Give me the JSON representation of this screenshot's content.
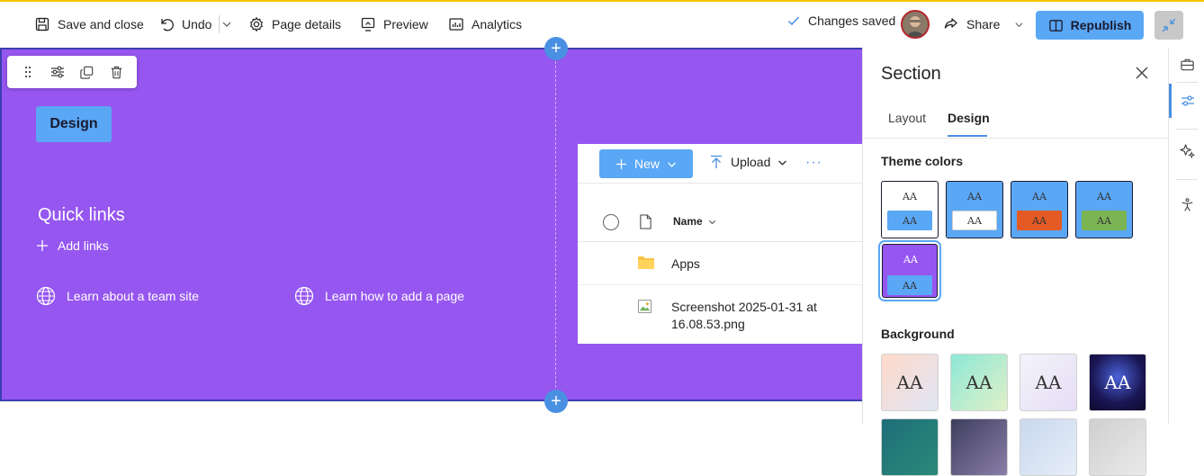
{
  "toolbar": {
    "save_close": "Save and close",
    "undo": "Undo",
    "page_details": "Page details",
    "preview": "Preview",
    "analytics": "Analytics",
    "status": "Changes saved",
    "share": "Share",
    "republish": "Republish"
  },
  "section": {
    "background": "#9656f0",
    "design_tag": "Design",
    "quick_links": {
      "title": "Quick links",
      "add": "Add links",
      "links": [
        "Learn about a team site",
        "Learn how to add a page"
      ]
    }
  },
  "doclib": {
    "new": "New",
    "upload": "Upload",
    "more": "···",
    "column_name": "Name",
    "rows": [
      "Apps",
      "Screenshot 2025-01-31 at 16.08.53.png"
    ]
  },
  "pane": {
    "title": "Section",
    "tabs": [
      "Layout",
      "Design"
    ],
    "active_tab": "Design",
    "theme_colors_label": "Theme colors",
    "background_label": "Background",
    "aa": "AA",
    "theme_colors": [
      {
        "top": "#ffffff",
        "bottom": "#5aa7f5"
      },
      {
        "top": "#5aa7f5",
        "bottom": "#ffffff"
      },
      {
        "top": "#5aa7f5",
        "bottom": "#e35a24"
      },
      {
        "top": "#5aa7f5",
        "bottom": "#7cb554"
      },
      {
        "top": "#9656f0",
        "bottom": "#5aa7f5",
        "selected": true
      }
    ]
  },
  "colors": {
    "accent": "#5aa7f5",
    "brand_bar": "#f5c400"
  }
}
